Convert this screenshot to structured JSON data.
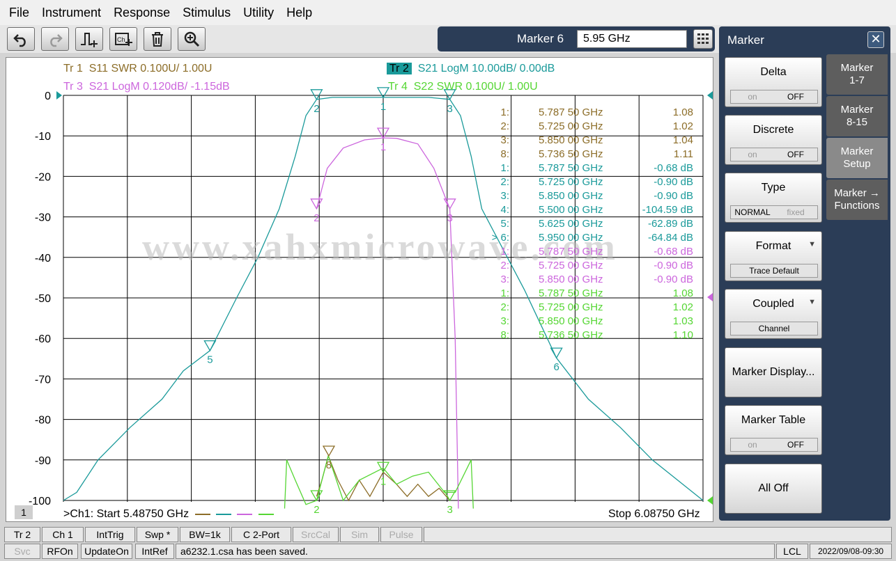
{
  "menu": [
    "File",
    "Instrument",
    "Response",
    "Stimulus",
    "Utility",
    "Help"
  ],
  "marker_entry": {
    "label": "Marker 6",
    "value": "5.95 GHz"
  },
  "traces": [
    {
      "id": "Tr 1",
      "text": "S11 SWR 0.100U/  1.00U",
      "color": "#8c6d28"
    },
    {
      "id": "Tr 2",
      "text": "S21 LogM 10.00dB/  0.00dB",
      "color": "#1a9a9a"
    },
    {
      "id": "Tr 3",
      "text": "S21 LogM 0.120dB/  -1.15dB",
      "color": "#cc66dd"
    },
    {
      "id": "Tr 4",
      "text": "S22 SWR 0.100U/  1.00U",
      "color": "#55d633"
    }
  ],
  "chart_data": {
    "type": "line",
    "x_label_start": ">Ch1:  Start  5.48750 GHz",
    "x_label_stop": "Stop  6.08750 GHz",
    "xlim": [
      5.4875,
      6.0875
    ],
    "ylim": [
      -102,
      0
    ],
    "yticks": [
      0,
      -10,
      -20,
      -30,
      -40,
      -50,
      -60,
      -70,
      -80,
      -90,
      -100
    ],
    "grid": true,
    "channel_badge": "1",
    "series": [
      {
        "trace": "Tr 2",
        "x": [
          5.4875,
          5.5,
          5.52,
          5.55,
          5.58,
          5.6,
          5.625,
          5.65,
          5.67,
          5.69,
          5.705,
          5.715,
          5.725,
          5.74,
          5.7875,
          5.83,
          5.85,
          5.86,
          5.87,
          5.88,
          5.9,
          5.92,
          5.95,
          5.98,
          6.01,
          6.04,
          6.0875
        ],
        "y": [
          -100,
          -98,
          -90,
          -82,
          -75,
          -68,
          -63,
          -50,
          -40,
          -28,
          -15,
          -5,
          -1,
          -0.5,
          -0.5,
          -0.5,
          -1,
          -5,
          -15,
          -28,
          -38,
          -48,
          -64.8,
          -75,
          -82,
          -90,
          -100
        ]
      },
      {
        "trace": "Tr 3",
        "x": [
          5.725,
          5.735,
          5.75,
          5.77,
          5.7875,
          5.8,
          5.82,
          5.835,
          5.85,
          5.855,
          5.858
        ],
        "y": [
          -28,
          -18,
          -13,
          -11,
          -10.5,
          -10.6,
          -12,
          -18,
          -28,
          -60,
          -102
        ]
      },
      {
        "trace": "Tr 1",
        "x": [
          5.725,
          5.73,
          5.736,
          5.745,
          5.755,
          5.765,
          5.775,
          5.7875,
          5.8,
          5.81,
          5.82,
          5.83,
          5.84,
          5.85
        ],
        "y": [
          -99,
          -95,
          -89,
          -95,
          -100,
          -95,
          -99,
          -93,
          -96,
          -99,
          -96,
          -99,
          -97,
          -100
        ]
      },
      {
        "trace": "Tr 4",
        "x": [
          5.695,
          5.697,
          5.705,
          5.715,
          5.725,
          5.736,
          5.75,
          5.765,
          5.7875,
          5.8,
          5.815,
          5.83,
          5.845,
          5.855,
          5.87,
          5.872
        ],
        "y": [
          -102,
          -90,
          -95,
          -101,
          -100,
          -89,
          -100,
          -95,
          -92,
          -96,
          -94,
          -93,
          -98,
          -98,
          -90,
          -102
        ]
      }
    ],
    "markers_plot": [
      {
        "n": "2",
        "x": 5.725,
        "y": -1,
        "color": "#1a9a9a"
      },
      {
        "n": "1",
        "x": 5.7875,
        "y": -0.5,
        "color": "#1a9a9a"
      },
      {
        "n": "3",
        "x": 5.85,
        "y": -1,
        "color": "#1a9a9a"
      },
      {
        "n": "1",
        "x": 5.7875,
        "y": -10.5,
        "color": "#cc66dd"
      },
      {
        "n": "2",
        "x": 5.725,
        "y": -28,
        "color": "#cc66dd"
      },
      {
        "n": "3",
        "x": 5.85,
        "y": -28,
        "color": "#cc66dd"
      },
      {
        "n": "5",
        "x": 5.625,
        "y": -63,
        "color": "#1a9a9a"
      },
      {
        "n": "6",
        "x": 5.95,
        "y": -64.8,
        "color": "#1a9a9a"
      },
      {
        "n": "8",
        "x": 5.7365,
        "y": -89,
        "color": "#8c6d28"
      },
      {
        "n": "2",
        "x": 5.725,
        "y": -100,
        "color": "#55d633"
      },
      {
        "n": "1",
        "x": 5.7875,
        "y": -93,
        "color": "#55d633"
      },
      {
        "n": "3",
        "x": 5.85,
        "y": -100,
        "color": "#55d633"
      }
    ]
  },
  "marker_table": [
    {
      "n": "1:",
      "f": "5.787 50 GHz",
      "v": "1.08",
      "color": "#8c6d28"
    },
    {
      "n": "2:",
      "f": "5.725 00 GHz",
      "v": "1.02",
      "color": "#8c6d28"
    },
    {
      "n": "3:",
      "f": "5.850 00 GHz",
      "v": "1.04",
      "color": "#8c6d28"
    },
    {
      "n": "8:",
      "f": "5.736 50 GHz",
      "v": "1.11",
      "color": "#8c6d28"
    },
    {
      "n": "1:",
      "f": "5.787 50 GHz",
      "v": "-0.68 dB",
      "color": "#1a9a9a"
    },
    {
      "n": "2:",
      "f": "5.725 00 GHz",
      "v": "-0.90 dB",
      "color": "#1a9a9a"
    },
    {
      "n": "3:",
      "f": "5.850 00 GHz",
      "v": "-0.90 dB",
      "color": "#1a9a9a"
    },
    {
      "n": "4:",
      "f": "5.500 00 GHz",
      "v": "-104.59 dB",
      "color": "#1a9a9a"
    },
    {
      "n": "5:",
      "f": "5.625 00 GHz",
      "v": "-62.89 dB",
      "color": "#1a9a9a"
    },
    {
      "n": "> 6:",
      "f": "5.950 00 GHz",
      "v": "-64.84 dB",
      "color": "#1a9a9a"
    },
    {
      "n": "1:",
      "f": "5.787 50 GHz",
      "v": "-0.68 dB",
      "color": "#cc66dd"
    },
    {
      "n": "2:",
      "f": "5.725 00 GHz",
      "v": "-0.90 dB",
      "color": "#cc66dd"
    },
    {
      "n": "3:",
      "f": "5.850 00 GHz",
      "v": "-0.90 dB",
      "color": "#cc66dd"
    },
    {
      "n": "1:",
      "f": "5.787 50 GHz",
      "v": "1.08",
      "color": "#55d633"
    },
    {
      "n": "2:",
      "f": "5.725 00 GHz",
      "v": "1.02",
      "color": "#55d633"
    },
    {
      "n": "3:",
      "f": "5.850 00 GHz",
      "v": "1.03",
      "color": "#55d633"
    },
    {
      "n": "8:",
      "f": "5.736 50 GHz",
      "v": "1.10",
      "color": "#55d633"
    }
  ],
  "watermark": "www.xahxmicrowave.com",
  "panel": {
    "title": "Marker",
    "close": "✕",
    "buttons": {
      "delta": {
        "label": "Delta",
        "on": "on",
        "off": "OFF"
      },
      "discrete": {
        "label": "Discrete",
        "on": "on",
        "off": "OFF"
      },
      "type": {
        "label": "Type",
        "a": "NORMAL",
        "b": "fixed"
      },
      "format": {
        "label": "Format",
        "sub": "Trace Default"
      },
      "coupled": {
        "label": "Coupled",
        "sub": "Channel"
      },
      "display": {
        "label": "Marker Display..."
      },
      "table": {
        "label": "Marker Table",
        "on": "on",
        "off": "OFF"
      },
      "alloff": {
        "label": "All Off"
      }
    },
    "tabs": [
      {
        "l1": "Marker",
        "l2": "1-7"
      },
      {
        "l1": "Marker",
        "l2": "8-15"
      },
      {
        "l1": "Marker",
        "l2": "Setup"
      },
      {
        "l1": "Marker →",
        "l2": "Functions"
      }
    ]
  },
  "status1": [
    "Tr 2",
    "Ch 1",
    "IntTrig",
    "Swp *",
    "BW=1k",
    "C  2-Port",
    "SrcCal",
    "Sim",
    "Pulse"
  ],
  "status2": {
    "svc": "Svc",
    "rfon": "RFOn",
    "update": "UpdateOn",
    "intref": "IntRef",
    "msg": "a6232.1.csa has been saved.",
    "lcl": "LCL",
    "time": "2022/09/08-09:30"
  }
}
